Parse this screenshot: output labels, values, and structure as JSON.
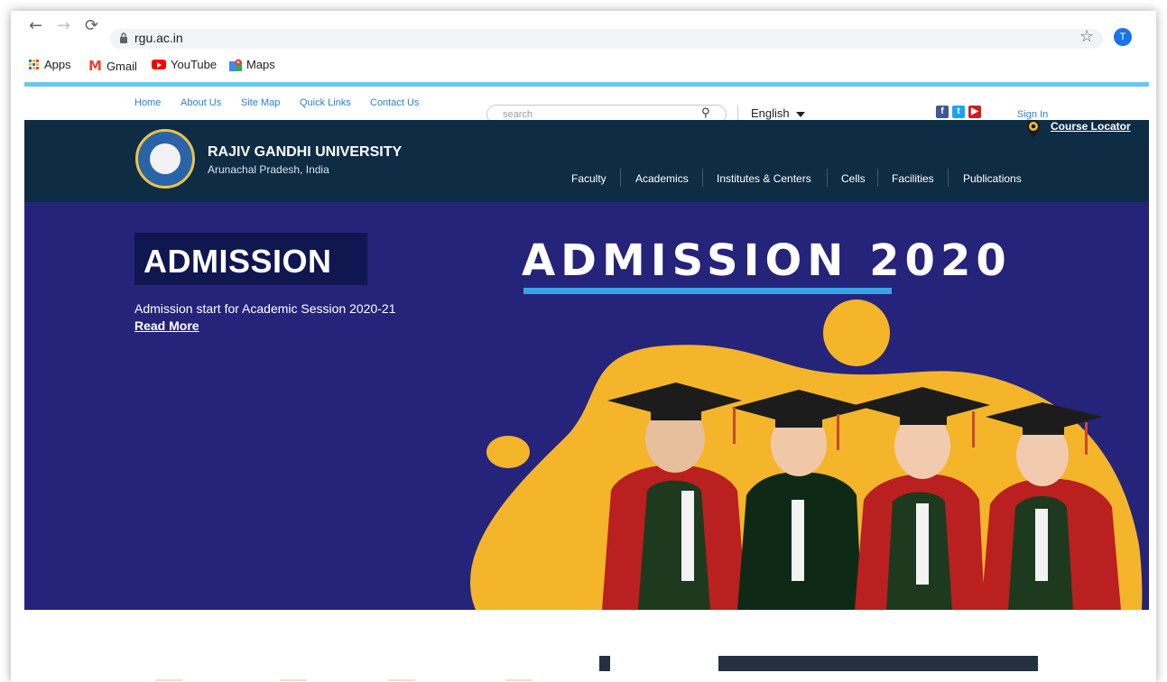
{
  "browser": {
    "url": "rgu.ac.in",
    "profile_initial": "T",
    "bookmarks": [
      {
        "label": "Apps",
        "icon": "apps-grid-icon"
      },
      {
        "label": "Gmail",
        "icon": "gmail-icon"
      },
      {
        "label": "YouTube",
        "icon": "youtube-icon"
      },
      {
        "label": "Maps",
        "icon": "maps-icon"
      }
    ]
  },
  "utility": {
    "links": [
      "Home",
      "About Us",
      "Site Map",
      "Quick Links",
      "Contact Us"
    ],
    "search_placeholder": "search",
    "language": "English",
    "sign_in": "Sign In",
    "course_locator": "Course Locator"
  },
  "header": {
    "university": "RAJIV GANDHI UNIVERSITY",
    "location": "Arunachal Pradesh, India",
    "nav": [
      "Faculty",
      "Academics",
      "Institutes & Centers",
      "Cells",
      "Facilities",
      "Publications"
    ]
  },
  "hero": {
    "title": "ADMISSION",
    "subtitle": "Admission start for Academic Session 2020-21",
    "read_more": "Read More",
    "banner_heading": "ADMISSION 2020"
  },
  "colors": {
    "header_bg": "#0f2c45",
    "hero_bg": "#25247a",
    "accent_blue": "#3aa2e6",
    "blob_yellow": "#f4b52a",
    "link_blue": "#2a7fc9"
  }
}
